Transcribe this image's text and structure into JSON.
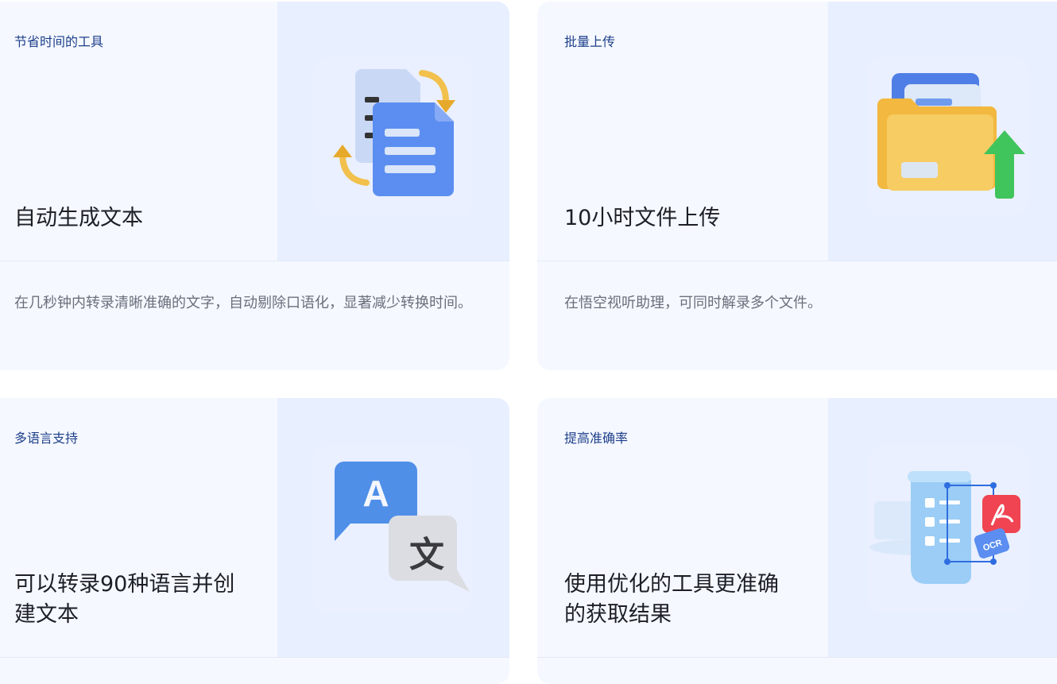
{
  "cards": [
    {
      "eyebrow": "节省时间的工具",
      "headline": "自动生成文本",
      "description": "在几秒钟内转录清晰准确的文字，自动剔除口语化，显著减少转换时间。",
      "icon": "document-convert-icon"
    },
    {
      "eyebrow": "批量上传",
      "headline": "10小时文件上传",
      "description": "在悟空视听助理，可同时解录多个文件。",
      "icon": "folder-upload-icon"
    },
    {
      "eyebrow": "多语言支持",
      "headline": "可以转录90种语言并创建文本",
      "description": "",
      "icon": "translate-icon"
    },
    {
      "eyebrow": "提高准确率",
      "headline": "使用优化的工具更准确的获取结果",
      "description": "",
      "icon": "ocr-pdf-icon",
      "badges": [
        "OCR"
      ]
    }
  ],
  "colors": {
    "card_bg": "#f5f8ff",
    "art_bg": "#e8efff",
    "eyebrow": "#1d3f8a",
    "accent_blue": "#4f86ee",
    "accent_yellow": "#f2c04c",
    "accent_green": "#3cc35a",
    "accent_red": "#f04452"
  }
}
